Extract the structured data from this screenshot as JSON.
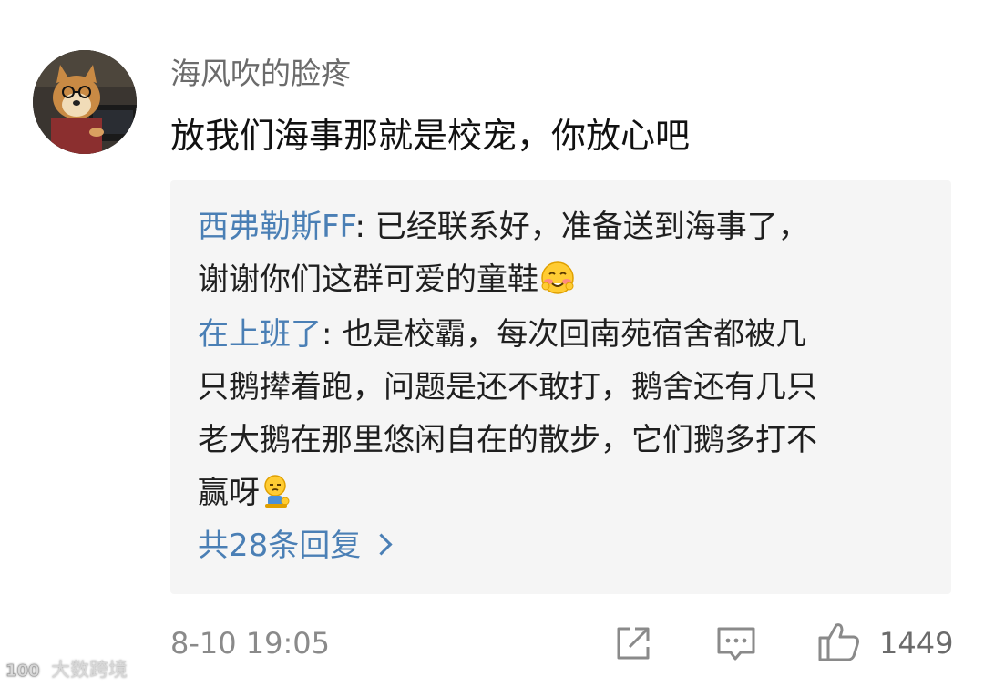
{
  "comment": {
    "username": "海风吹的脸疼",
    "text": "放我们海事那就是校宠，你放心吧",
    "timestamp": "8-10 19:05",
    "avatar_icon": "shiba-dog-avatar"
  },
  "replies": [
    {
      "author": "西弗勒斯FF",
      "separator": ": ",
      "line1": "已经联系好，准备送到海事了，",
      "line2": "谢谢你们这群可爱的童鞋",
      "emoji": "blushing-smile-emoji"
    },
    {
      "author": "在上班了",
      "separator": ": ",
      "line1": "也是校霸，每次回南苑宿舍都被几",
      "line2": "只鹅撵着跑，问题是还不敢打，鹅舍还有几只",
      "line3": "老大鹅在那里悠闲自在的散步，它们鹅多打不",
      "line4": "赢呀",
      "emoji": "sitting-pout-emoji"
    }
  ],
  "more_replies": {
    "label": "共28条回复",
    "icon": "chevron-right-icon"
  },
  "actions": {
    "share_icon": "share-icon",
    "comment_icon": "comment-icon",
    "like_icon": "thumbs-up-icon",
    "like_count": "1449"
  },
  "watermark": {
    "text": "大数跨境",
    "logo_text": "100",
    "icon": "watermark-logo"
  },
  "colors": {
    "link_blue": "#4a7fb5",
    "reply_bg": "#f5f5f5",
    "muted_gray": "#8a8a8a"
  }
}
